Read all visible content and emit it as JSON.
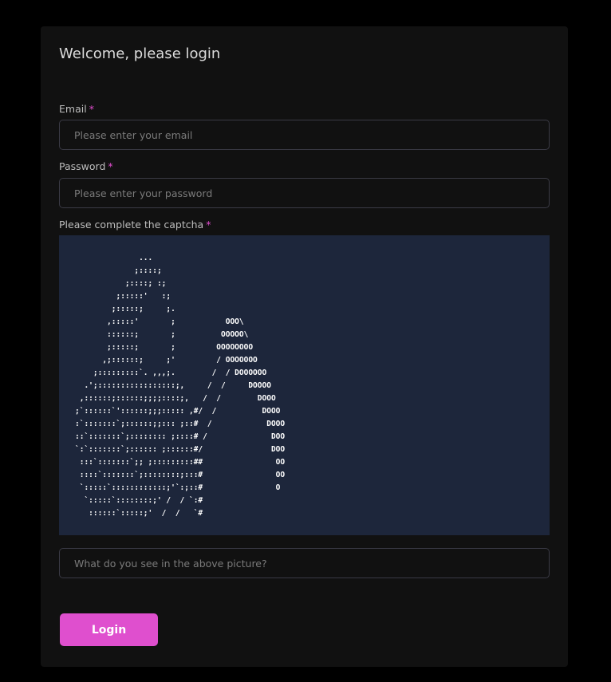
{
  "form": {
    "title": "Welcome, please login",
    "required_marker": "*",
    "email": {
      "label": "Email",
      "placeholder": "Please enter your email",
      "value": ""
    },
    "password": {
      "label": "Password",
      "placeholder": "Please enter your password",
      "value": ""
    },
    "captcha": {
      "label": "Please complete the captcha",
      "art": "              ...\n             ;::::;\n           ;::::; :;\n         ;:::::'   :;\n        ;:::::;     ;.\n       ,:::::'       ;           OOO\\\n       ::::::;       ;          OOOOO\\\n       ;:::::;       ;         OOOOOOOO\n      ,;::::::;     ;'         / OOOOOOO\n    ;:::::::::`. ,,,;.        /  / DOOOOOO\n  .';:::::::::::::::::;,     /  /     DOOOO\n ,::::::;::::::;;;;::::;,   /  /        DOOO\n;`::::::`'::::::;;;::::: ,#/  /          DOOO\n:`:::::::`;::::::;;::: ;::#  /            DOOO\n::`:::::::`;:::::::: ;::::# /              DOO\n`:`:::::::`;:::::: ;::::::#/               DOO\n :::`:::::::`;; ;:::::::::##                OO\n ::::`:::::::`;::::::::;:::#                OO\n `:::::`::::::::::::;'`:;::#                O\n  `:::::`::::::::;' /  / `:#\n   ::::::`:::::;'  /  /   `#",
      "answer_placeholder": "What do you see in the above picture?",
      "answer_value": ""
    },
    "submit_label": "Login"
  },
  "colors": {
    "page_background": "#000000",
    "card_background": "#111111",
    "captcha_background": "#1d263b",
    "accent": "#df4fce",
    "input_border": "#3a3a45"
  }
}
